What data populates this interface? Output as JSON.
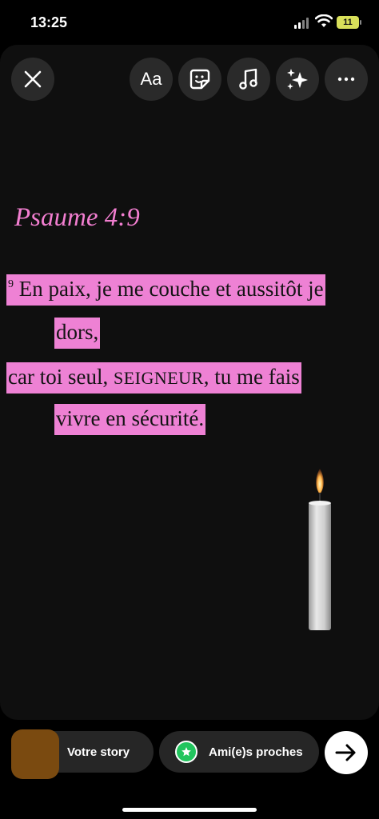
{
  "status_bar": {
    "time": "13:25",
    "battery": "11"
  },
  "toolbar": {
    "close_icon": "close-icon",
    "text_label": "Aa",
    "sticker_icon": "sticker-icon",
    "music_icon": "music-note-icon",
    "effects_icon": "sparkles-icon",
    "more_icon": "more-icon"
  },
  "story": {
    "reference": "Psaume 4:9",
    "verse_number": "9",
    "line1": " En paix, je me couche et aussitôt je",
    "line2": "dors,",
    "line3_a": "car toi seul, ",
    "line3_lord": "SEIGNEUR",
    "line3_b": ", tu me fais",
    "line4": "vivre en sécurité."
  },
  "share": {
    "your_story_label": "Votre story",
    "close_friends_label": "Ami(e)s proches"
  },
  "colors": {
    "highlight": "#ee81d4",
    "reference": "#f27ed0",
    "close_friends": "#22c55e"
  }
}
